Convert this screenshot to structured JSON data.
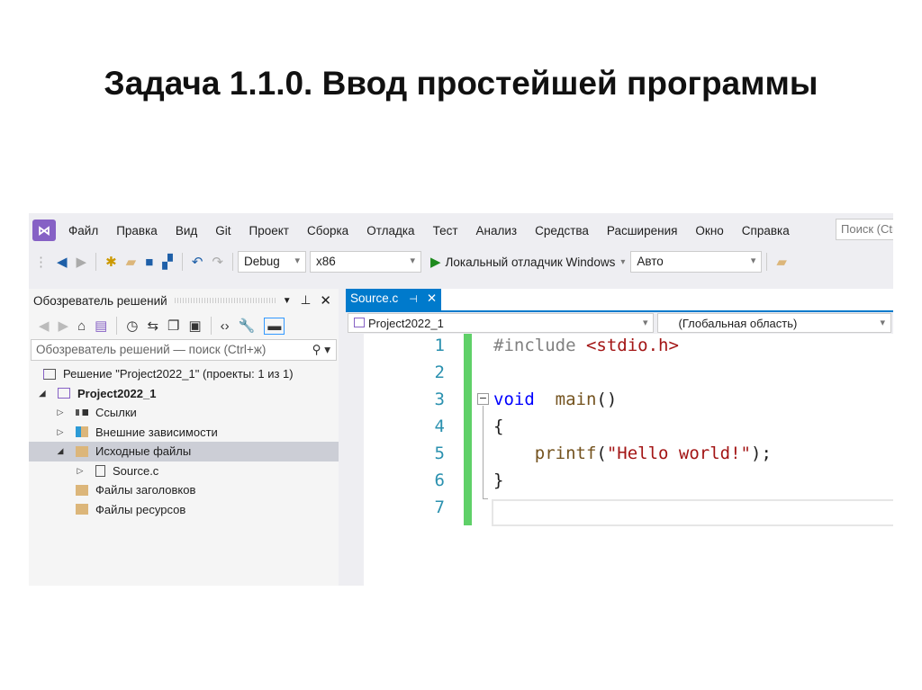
{
  "slide_title": "Задача 1.1.0. Ввод простейшей программы",
  "menu": {
    "items": [
      "Файл",
      "Правка",
      "Вид",
      "Git",
      "Проект",
      "Сборка",
      "Отладка",
      "Тест",
      "Анализ",
      "Средства",
      "Расширения",
      "Окно",
      "Справка"
    ],
    "search_placeholder": "Поиск (Ctrl+Q)"
  },
  "toolbar": {
    "config": "Debug",
    "platform": "x86",
    "run_label": "Локальный отладчик Windows",
    "target": "Авто"
  },
  "solution_explorer": {
    "title": "Обозреватель решений",
    "search_placeholder": "Обозреватель решений — поиск (Ctrl+ж)",
    "tree": [
      {
        "label": "Решение \"Project2022_1\" (проекты: 1 из 1)"
      },
      {
        "label": "Project2022_1"
      },
      {
        "label": "Ссылки"
      },
      {
        "label": "Внешние зависимости"
      },
      {
        "label": "Исходные файлы"
      },
      {
        "label": "Source.c"
      },
      {
        "label": "Файлы заголовков"
      },
      {
        "label": "Файлы ресурсов"
      }
    ]
  },
  "editor": {
    "tab": "Source.c",
    "project_dropdown": "Project2022_1",
    "scope_dropdown": "(Глобальная область)",
    "line_numbers": [
      "1",
      "2",
      "3",
      "4",
      "5",
      "6",
      "7"
    ],
    "lines": {
      "l1a": "#include ",
      "l1b": "<stdio.h>",
      "l3a": "void",
      "l3b": "  main",
      "l3c": "()",
      "l4": "{",
      "l5a": "    printf",
      "l5b": "(",
      "l5c": "\"Hello world!\"",
      "l5d": ");",
      "l6": "}"
    }
  }
}
